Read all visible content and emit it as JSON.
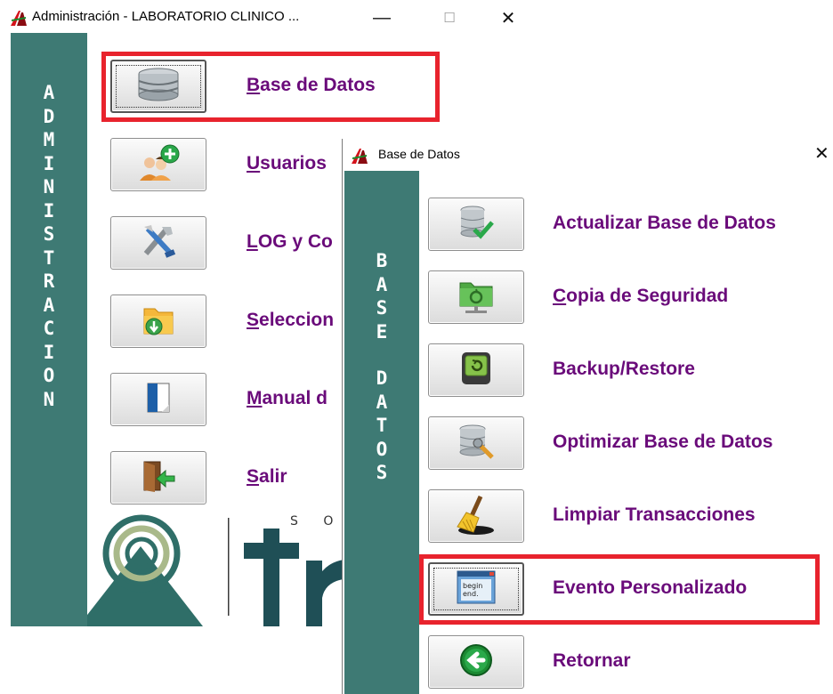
{
  "main_window": {
    "title": "Administración - LABORATORIO CLINICO ...",
    "sidebar_text": "ADMINISTRACION",
    "menu": [
      {
        "key": "base-de-datos",
        "mnemonic": "B",
        "rest": "ase de Datos",
        "icon": "database-icon",
        "highlighted": true
      },
      {
        "key": "usuarios",
        "mnemonic": "U",
        "rest": "suarios",
        "icon": "add-user-icon",
        "highlighted": false
      },
      {
        "key": "log",
        "mnemonic": "L",
        "rest": "OG y Co",
        "icon": "tools-icon",
        "highlighted": false
      },
      {
        "key": "seleccion",
        "mnemonic": "S",
        "rest": "eleccion",
        "icon": "folder-download-icon",
        "highlighted": false
      },
      {
        "key": "manual",
        "mnemonic": "M",
        "rest": "anual d",
        "icon": "document-icon",
        "highlighted": false
      },
      {
        "key": "salir",
        "mnemonic": "S",
        "rest": "alir",
        "icon": "exit-door-icon",
        "highlighted": false
      }
    ],
    "logo_text": "S O"
  },
  "dialog": {
    "title": "Base de Datos",
    "sidebar_words": [
      "BASE",
      "DATOS"
    ],
    "menu": [
      {
        "key": "actualizar",
        "mnemonic": "",
        "rest": "Actualizar Base de Datos",
        "icon": "database-check-icon",
        "highlighted": false
      },
      {
        "key": "copia",
        "mnemonic": "C",
        "rest": "opia de Seguridad",
        "icon": "backup-folder-icon",
        "highlighted": false
      },
      {
        "key": "backup",
        "mnemonic": "",
        "rest": "Backup/Restore",
        "icon": "restore-drive-icon",
        "highlighted": false
      },
      {
        "key": "optimizar",
        "mnemonic": "",
        "rest": "Optimizar Base de Datos",
        "icon": "database-tools-icon",
        "highlighted": false
      },
      {
        "key": "limpiar",
        "mnemonic": "",
        "rest": "Limpiar Transacciones",
        "icon": "broom-icon",
        "highlighted": false
      },
      {
        "key": "evento",
        "mnemonic": "",
        "rest": "Evento Personalizado",
        "icon": "script-window-icon",
        "highlighted": true
      },
      {
        "key": "retornar",
        "mnemonic": "",
        "rest": "Retornar",
        "icon": "back-arrow-icon",
        "highlighted": false
      }
    ],
    "script_icon_text": "begin end"
  },
  "colors": {
    "sidebar": "#3e7a74",
    "label": "#6a0b7a",
    "highlight": "#e8232d"
  }
}
